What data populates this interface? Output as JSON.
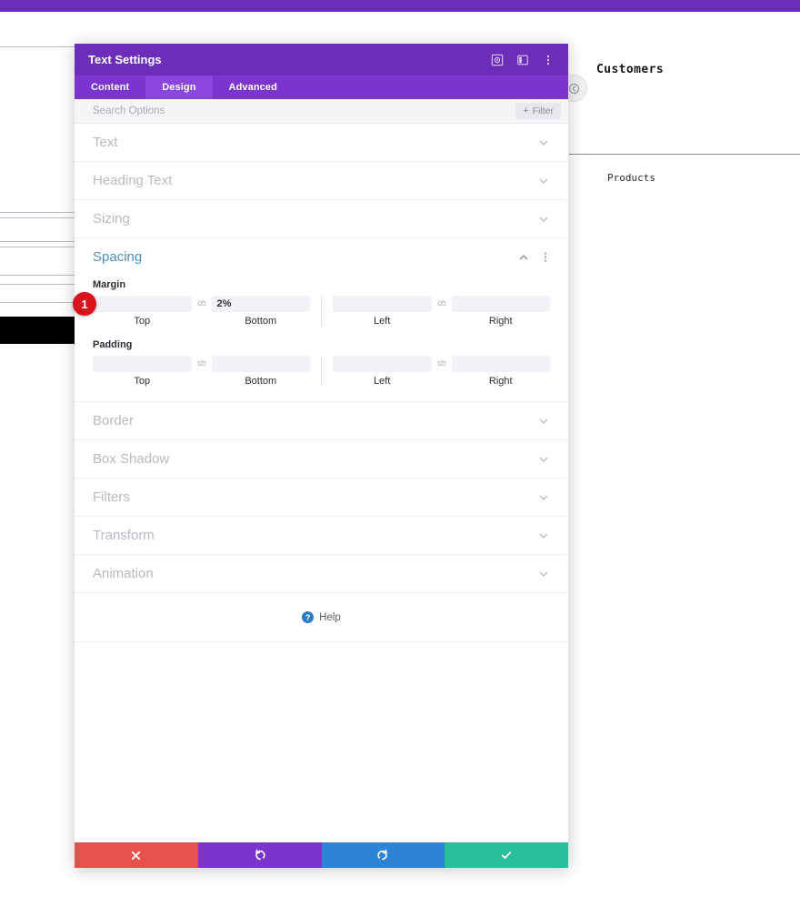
{
  "page": {
    "top_bar_color": "#6c2eb9",
    "background_rules_y": [
      51,
      233,
      239,
      265,
      271,
      302,
      312,
      332
    ],
    "customers_heading": "Customers",
    "products_label": "Products",
    "collapse_handle_icon": "collapse-left-icon"
  },
  "modal": {
    "title": "Text Settings",
    "header_icons": [
      {
        "name": "focus-target-icon"
      },
      {
        "name": "layout-toggle-icon"
      },
      {
        "name": "kebab-menu-icon"
      }
    ],
    "tabs": [
      {
        "label": "Content",
        "active": false
      },
      {
        "label": "Design",
        "active": true
      },
      {
        "label": "Advanced",
        "active": false
      }
    ],
    "search": {
      "placeholder": "Search Options",
      "value": "",
      "filter_label": "Filter",
      "filter_plus": "+"
    },
    "sections": [
      {
        "label": "Text",
        "open": false
      },
      {
        "label": "Heading Text",
        "open": false
      },
      {
        "label": "Sizing",
        "open": false
      },
      {
        "label": "Spacing",
        "open": true
      },
      {
        "label": "Border",
        "open": false
      },
      {
        "label": "Box Shadow",
        "open": false
      },
      {
        "label": "Filters",
        "open": false
      },
      {
        "label": "Transform",
        "open": false
      },
      {
        "label": "Animation",
        "open": false
      }
    ],
    "spacing": {
      "margin": {
        "label": "Margin",
        "fields": [
          {
            "caption": "Top",
            "value": ""
          },
          {
            "caption": "Bottom",
            "value": "2%"
          },
          {
            "caption": "Left",
            "value": ""
          },
          {
            "caption": "Right",
            "value": ""
          }
        ],
        "link_icon": "broken-link-icon",
        "link_glyph": "c/ɔ"
      },
      "padding": {
        "label": "Padding",
        "fields": [
          {
            "caption": "Top",
            "value": ""
          },
          {
            "caption": "Bottom",
            "value": ""
          },
          {
            "caption": "Left",
            "value": ""
          },
          {
            "caption": "Right",
            "value": ""
          }
        ],
        "link_icon": "broken-link-icon",
        "link_glyph": "c/ɔ"
      }
    },
    "help": {
      "label": "Help",
      "icon_glyph": "?"
    },
    "footer_buttons": [
      {
        "name": "cancel-button",
        "glyph": "✖",
        "color": "#e8514b"
      },
      {
        "name": "undo-button",
        "glyph": "↺",
        "color": "#7b34cd"
      },
      {
        "name": "redo-button",
        "glyph": "↻",
        "color": "#2a84d2"
      },
      {
        "name": "save-button",
        "glyph": "✔",
        "color": "#28bf9a"
      }
    ]
  },
  "annotation": {
    "step_badge": "1"
  }
}
